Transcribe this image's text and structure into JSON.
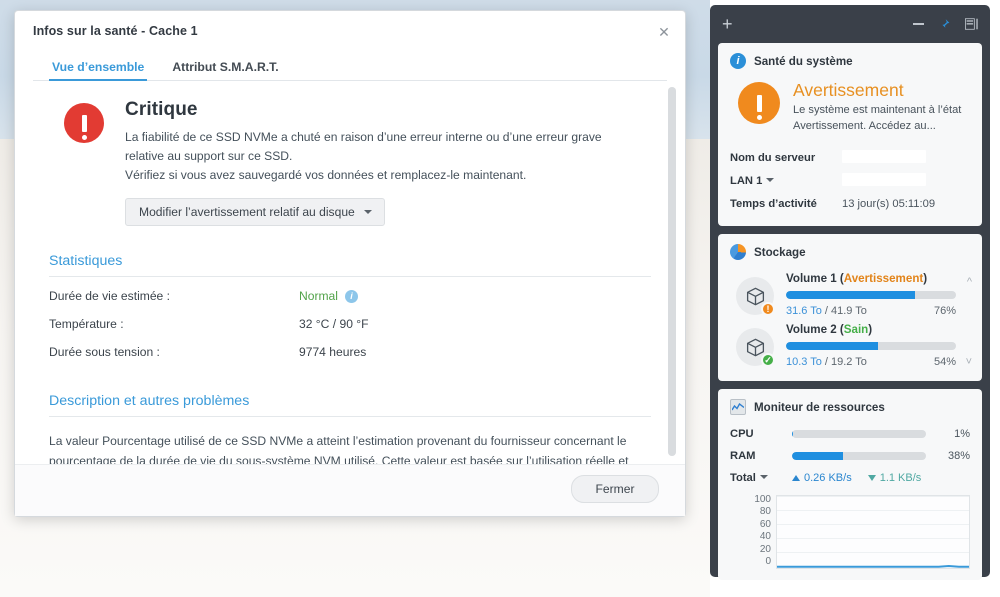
{
  "dialog": {
    "title": "Infos sur la santé - Cache 1",
    "close_icon": "close-icon",
    "tabs": [
      {
        "label": "Vue d’ensemble",
        "active": true
      },
      {
        "label": "Attribut S.M.A.R.T.",
        "active": false
      }
    ],
    "critical": {
      "icon": "exclamation-circle-icon",
      "heading": "Critique",
      "line1": "La fiabilité de ce SSD NVMe a chuté en raison d’une erreur interne ou d’une erreur grave relative au support sur ce SSD.",
      "line2": "Vérifiez si vous avez sauvegardé vos données et remplacez-le maintenant.",
      "button_label": "Modifier l’avertissement relatif au disque",
      "icon_color": "#e23b33"
    },
    "statistics": {
      "heading": "Statistiques",
      "rows": [
        {
          "key": "Durée de vie estimée :",
          "value": "Normal",
          "style": "green",
          "info_icon": "info-icon"
        },
        {
          "key": "Température :",
          "value": "32 °C / 90 °F",
          "style": "plain",
          "info_icon": ""
        },
        {
          "key": "Durée sous tension :",
          "value": "9774 heures",
          "style": "plain",
          "info_icon": ""
        }
      ]
    },
    "description": {
      "heading": "Description et autres problèmes",
      "body": "La valeur Pourcentage utilisé de ce SSD NVMe a atteint l’estimation provenant du fournisseur concernant le pourcentage de la durée de vie du sous-système NVM utilisé. Cette valeur est basée sur l’utilisation réelle et sur les prévisions du fabricant concernant la durée de vie du NVM."
    },
    "footer": {
      "close_label": "Fermer"
    }
  },
  "widget_panel": {
    "toolbar": {
      "add_icon": "plus-icon",
      "minimize_icon": "minimize-icon",
      "pin_icon": "pin-icon",
      "layout_icon": "panel-layout-icon",
      "pin_color": "#2a8fd8"
    },
    "system_health": {
      "icon": "info-circle-icon",
      "title": "Santé du système",
      "status": "Avertissement",
      "status_color": "#e79022",
      "status_icon": "warning-exclamation-icon",
      "description_line1": "Le système est maintenant à l’état",
      "description_line2": "Avertissement. Accédez au...",
      "rows": [
        {
          "label": "Nom du serveur",
          "value": "",
          "redacted": true,
          "dropdown": false
        },
        {
          "label": "LAN 1",
          "value": "",
          "redacted": true,
          "dropdown": true
        },
        {
          "label": "Temps d’activité",
          "value": "13 jour(s) 05:11:09",
          "redacted": false,
          "dropdown": false
        }
      ]
    },
    "storage": {
      "icon": "pie-chart-icon",
      "title": "Stockage",
      "scroll_up_icon": "chevron-up-icon",
      "scroll_down_icon": "chevron-down-icon",
      "volumes": [
        {
          "name": "Volume 1",
          "state": "Avertissement",
          "state_type": "warning",
          "badge_icon": "warning-badge-icon",
          "used": "31.6 To",
          "total": "41.9 To",
          "percent_label": "76%",
          "percent": 76
        },
        {
          "name": "Volume 2",
          "state": "Sain",
          "state_type": "ok",
          "badge_icon": "check-badge-icon",
          "used": "10.3 To",
          "total": "19.2 To",
          "percent_label": "54%",
          "percent": 54
        }
      ]
    },
    "resource_monitor": {
      "icon": "resource-graph-icon",
      "title": "Moniteur de ressources",
      "rows": [
        {
          "label": "CPU",
          "percent_label": "1%",
          "percent": 1
        },
        {
          "label": "RAM",
          "percent_label": "38%",
          "percent": 38
        }
      ],
      "network": {
        "label": "Total",
        "upload_icon": "upload-arrow-icon",
        "upload": "0.26 KB/s",
        "download_icon": "download-arrow-icon",
        "download": "1.1 KB/s"
      }
    }
  },
  "chart_data": {
    "type": "line",
    "title": "",
    "xlabel": "",
    "ylabel": "",
    "ylim": [
      0,
      100
    ],
    "yticks": [
      100,
      80,
      60,
      40,
      20,
      0
    ],
    "grid": true,
    "legend": "none",
    "series": [
      {
        "name": "Total",
        "color": "#3a9ad9",
        "values": [
          0,
          0,
          0,
          0,
          0,
          0,
          0,
          0,
          0,
          0,
          0,
          0,
          0,
          0,
          0,
          0,
          0,
          1,
          0,
          0
        ]
      }
    ]
  }
}
